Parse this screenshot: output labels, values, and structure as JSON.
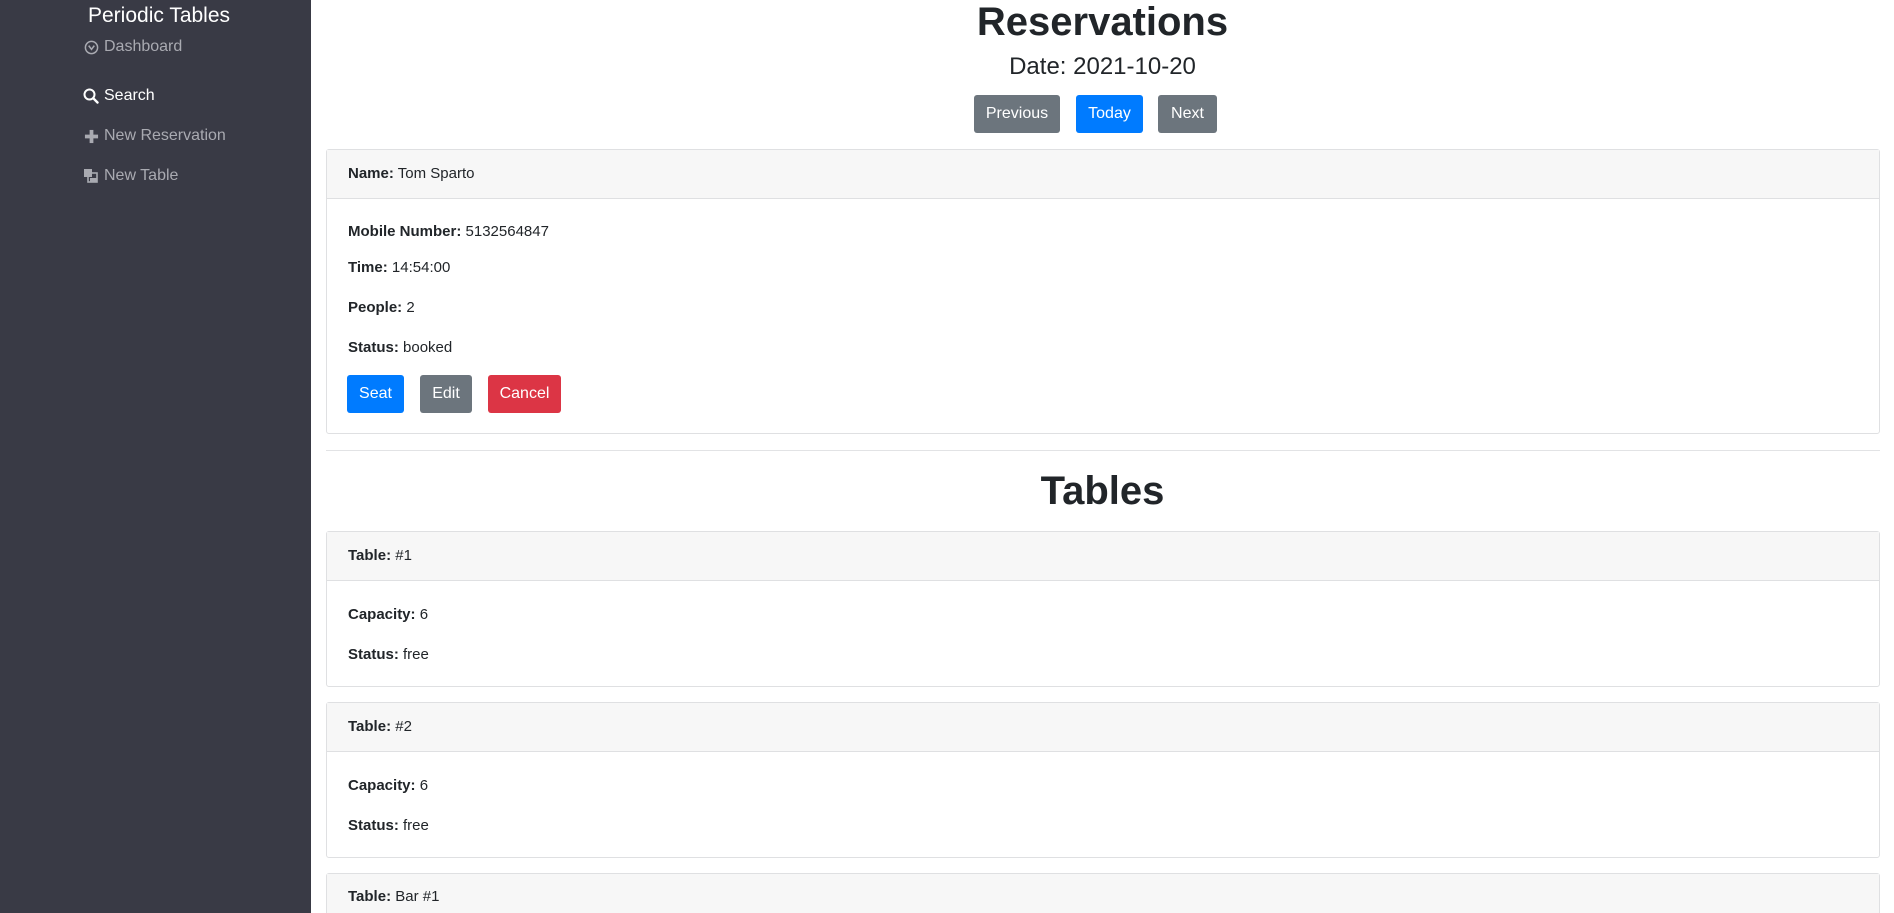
{
  "sidebar": {
    "brand": "Periodic Tables",
    "items": [
      {
        "label": "Dashboard",
        "icon": "dashboard-icon",
        "active": false
      },
      {
        "label": "Search",
        "icon": "search-icon",
        "active": true
      },
      {
        "label": "New Reservation",
        "icon": "plus-icon",
        "active": false
      },
      {
        "label": "New Table",
        "icon": "layers-icon",
        "active": false
      }
    ]
  },
  "reservations": {
    "title": "Reservations",
    "date_label": "Date: 2021-10-20",
    "nav_buttons": {
      "previous": "Previous",
      "today": "Today",
      "next": "Next"
    },
    "items": [
      {
        "name_label": "Name:",
        "name": "Tom Sparto",
        "mobile_label": "Mobile Number:",
        "mobile": "5132564847",
        "time_label": "Time:",
        "time": "14:54:00",
        "people_label": "People:",
        "people": "2",
        "status_label": "Status:",
        "status": "booked",
        "actions": {
          "seat": "Seat",
          "edit": "Edit",
          "cancel": "Cancel"
        }
      }
    ]
  },
  "tables": {
    "title": "Tables",
    "items": [
      {
        "table_label": "Table:",
        "table": "#1",
        "capacity_label": "Capacity:",
        "capacity": "6",
        "status_label": "Status:",
        "status": "free"
      },
      {
        "table_label": "Table:",
        "table": "#2",
        "capacity_label": "Capacity:",
        "capacity": "6",
        "status_label": "Status:",
        "status": "free"
      },
      {
        "table_label": "Table:",
        "table": "Bar #1"
      }
    ]
  },
  "colors": {
    "sidebar_bg": "#393a45",
    "primary": "#007bff",
    "secondary": "#6c757d",
    "danger": "#dc3545"
  }
}
